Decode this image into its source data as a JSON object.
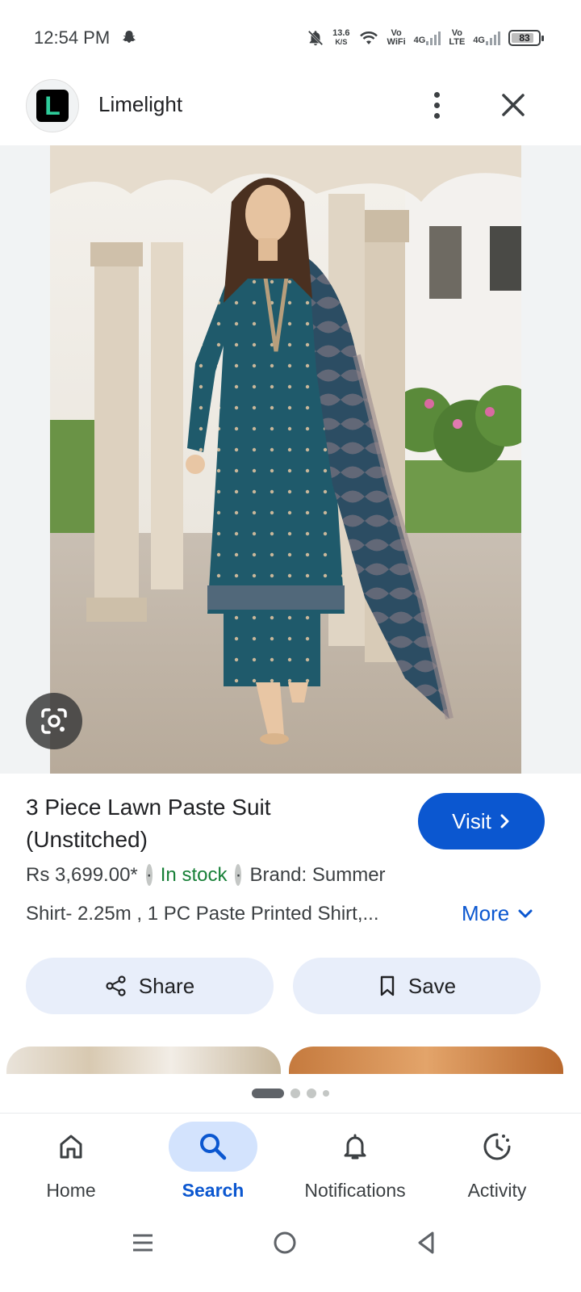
{
  "status_bar": {
    "time": "12:54 PM",
    "net_speed": "13.6",
    "net_unit": "K/S",
    "vo_wifi_top": "Vo",
    "vo_wifi_bottom": "WiFi",
    "net1": "4G",
    "vo_lte_top": "Vo",
    "vo_lte_bottom": "LTE",
    "net2": "4G",
    "battery": "83",
    "battery_level": 0.83
  },
  "header": {
    "logo_letter": "L",
    "site_name": "Limelight"
  },
  "product": {
    "title": "3 Piece Lawn Paste Suit (Unstitched)",
    "visit_label": "Visit",
    "price": "Rs 3,699.00*",
    "separator": "·",
    "stock": "In stock",
    "brand": "Brand: Summer",
    "description": "Shirt- 2.25m , 1 PC Paste Printed Shirt,...",
    "more_label": "More",
    "share_label": "Share",
    "save_label": "Save"
  },
  "colors": {
    "accent": "#0b57d0",
    "in_stock": "#188038",
    "action_bg": "#e8eefa",
    "dress": "#1f5a6b"
  },
  "bottom_nav": {
    "items": [
      {
        "label": "Home",
        "icon": "home-icon"
      },
      {
        "label": "Search",
        "icon": "search-icon",
        "active": true
      },
      {
        "label": "Notifications",
        "icon": "bell-icon"
      },
      {
        "label": "Activity",
        "icon": "activity-icon"
      }
    ]
  },
  "carousel": {
    "pages": 4,
    "active": 0
  }
}
